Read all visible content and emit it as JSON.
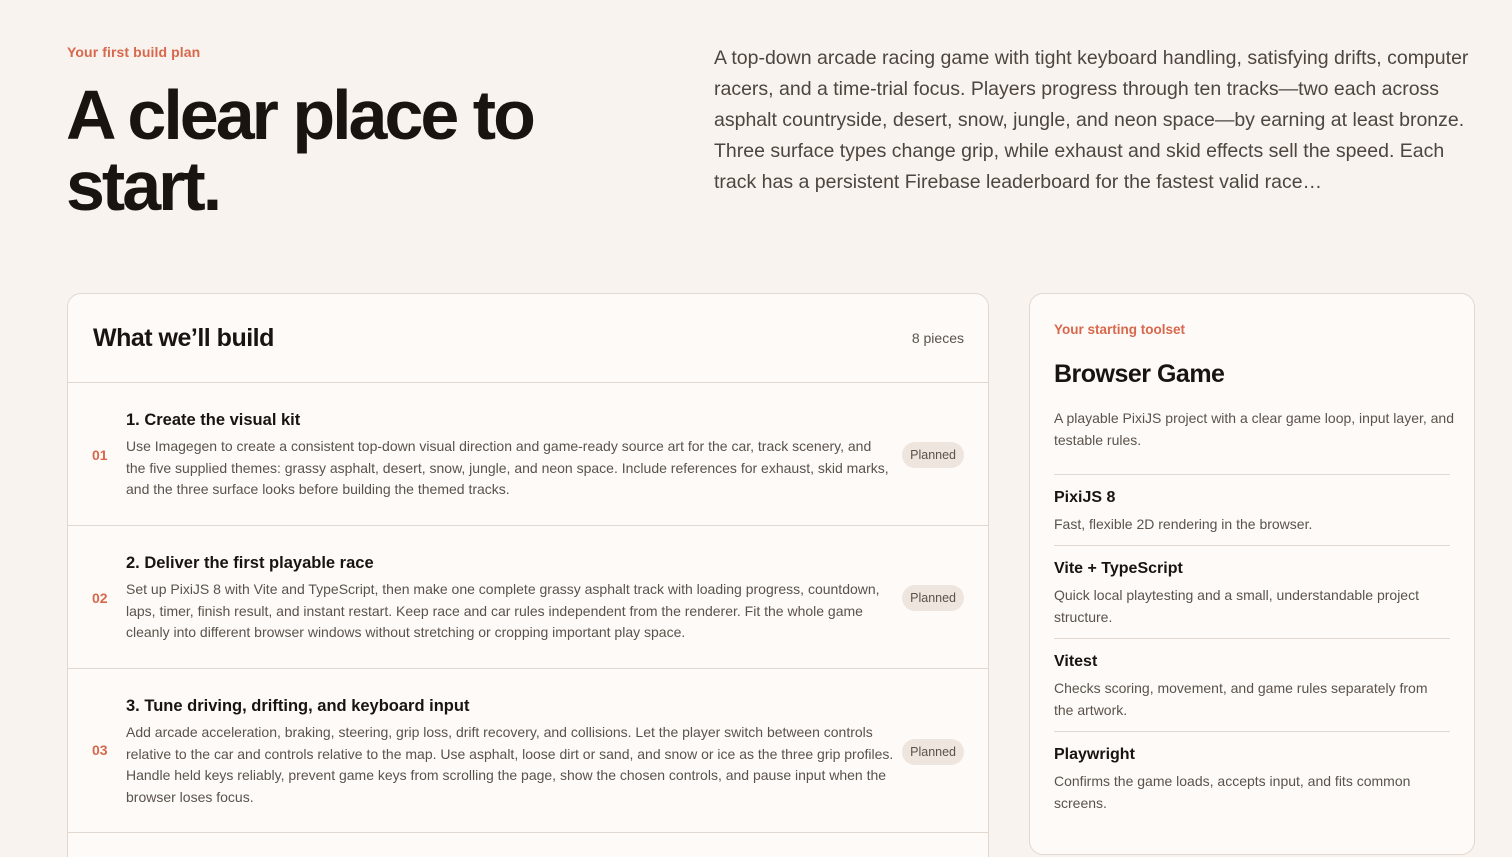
{
  "hero": {
    "eyebrow": "Your first build plan",
    "title": "A clear place to start.",
    "description": "A top-down arcade racing game with tight keyboard handling, satisfying drifts, computer racers, and a time-trial focus. Players progress through ten tracks—two each across asphalt countryside, desert, snow, jungle, and neon space—by earning at least bronze. Three surface types change grip, while exhaust and skid effects sell the speed. Each track has a persistent Firebase leaderboard for the fastest valid race…"
  },
  "build": {
    "title": "What we’ll build",
    "count": "8 pieces",
    "steps": [
      {
        "num": "01",
        "title": "1. Create the visual kit",
        "desc": "Use Imagegen to create a consistent top-down visual direction and game-ready source art for the car, track scenery, and the five supplied themes: grassy asphalt, desert, snow, jungle, and neon space. Include references for exhaust, skid marks, and the three surface looks before building the themed tracks.",
        "status": "Planned"
      },
      {
        "num": "02",
        "title": "2. Deliver the first playable race",
        "desc": "Set up PixiJS 8 with Vite and TypeScript, then make one complete grassy asphalt track with loading progress, countdown, laps, timer, finish result, and instant restart. Keep race and car rules independent from the renderer. Fit the whole game cleanly into different browser windows without stretching or cropping important play space.",
        "status": "Planned"
      },
      {
        "num": "03",
        "title": "3. Tune driving, drifting, and keyboard input",
        "desc": "Add arcade acceleration, braking, steering, grip loss, drift recovery, and collisions. Let the player switch between controls relative to the car and controls relative to the map. Use asphalt, loose dirt or sand, and snow or ice as the three grip profiles. Handle held keys reliably, prevent game keys from scrolling the page, show the chosen controls, and pause input when the browser loses focus.",
        "status": "Planned"
      }
    ]
  },
  "toolset": {
    "eyebrow": "Your starting toolset",
    "title": "Browser Game",
    "description": "A playable PixiJS project with a clear game loop, input layer, and testable rules.",
    "items": [
      {
        "name": "PixiJS 8",
        "desc": "Fast, flexible 2D rendering in the browser."
      },
      {
        "name": "Vite + TypeScript",
        "desc": "Quick local playtesting and a small, understandable project structure."
      },
      {
        "name": "Vitest",
        "desc": "Checks scoring, movement, and game rules separately from the artwork."
      },
      {
        "name": "Playwright",
        "desc": "Confirms the game loads, accepts input, and fits common screens."
      }
    ]
  }
}
